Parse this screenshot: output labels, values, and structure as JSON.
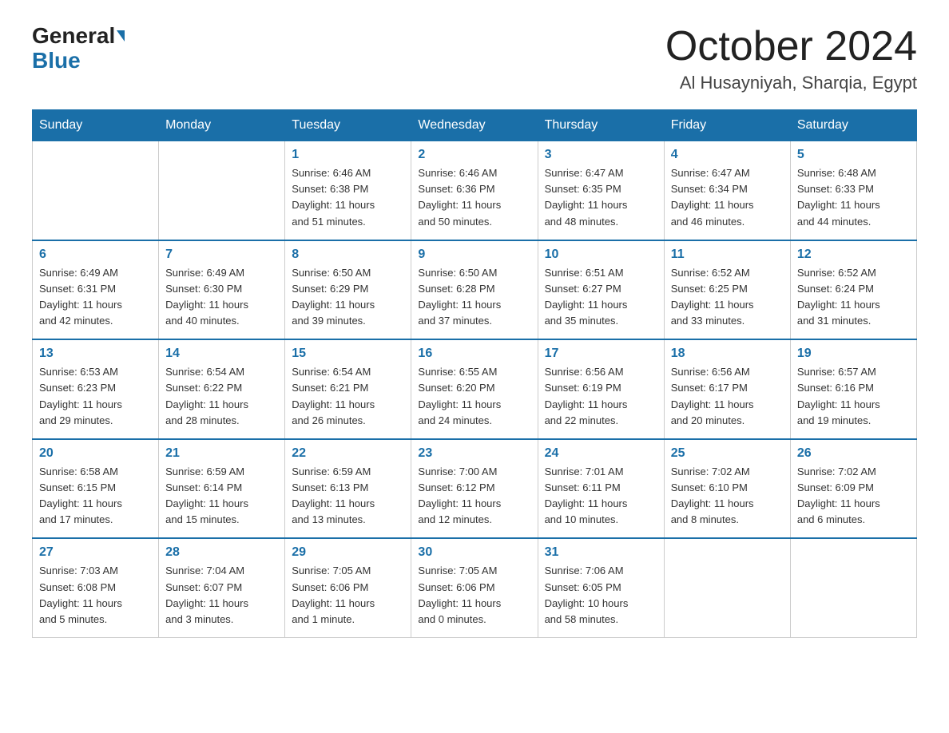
{
  "header": {
    "logo_general": "General",
    "logo_blue": "Blue",
    "title": "October 2024",
    "subtitle": "Al Husayniyah, Sharqia, Egypt"
  },
  "weekdays": [
    "Sunday",
    "Monday",
    "Tuesday",
    "Wednesday",
    "Thursday",
    "Friday",
    "Saturday"
  ],
  "weeks": [
    [
      {
        "day": "",
        "info": ""
      },
      {
        "day": "",
        "info": ""
      },
      {
        "day": "1",
        "info": "Sunrise: 6:46 AM\nSunset: 6:38 PM\nDaylight: 11 hours\nand 51 minutes."
      },
      {
        "day": "2",
        "info": "Sunrise: 6:46 AM\nSunset: 6:36 PM\nDaylight: 11 hours\nand 50 minutes."
      },
      {
        "day": "3",
        "info": "Sunrise: 6:47 AM\nSunset: 6:35 PM\nDaylight: 11 hours\nand 48 minutes."
      },
      {
        "day": "4",
        "info": "Sunrise: 6:47 AM\nSunset: 6:34 PM\nDaylight: 11 hours\nand 46 minutes."
      },
      {
        "day": "5",
        "info": "Sunrise: 6:48 AM\nSunset: 6:33 PM\nDaylight: 11 hours\nand 44 minutes."
      }
    ],
    [
      {
        "day": "6",
        "info": "Sunrise: 6:49 AM\nSunset: 6:31 PM\nDaylight: 11 hours\nand 42 minutes."
      },
      {
        "day": "7",
        "info": "Sunrise: 6:49 AM\nSunset: 6:30 PM\nDaylight: 11 hours\nand 40 minutes."
      },
      {
        "day": "8",
        "info": "Sunrise: 6:50 AM\nSunset: 6:29 PM\nDaylight: 11 hours\nand 39 minutes."
      },
      {
        "day": "9",
        "info": "Sunrise: 6:50 AM\nSunset: 6:28 PM\nDaylight: 11 hours\nand 37 minutes."
      },
      {
        "day": "10",
        "info": "Sunrise: 6:51 AM\nSunset: 6:27 PM\nDaylight: 11 hours\nand 35 minutes."
      },
      {
        "day": "11",
        "info": "Sunrise: 6:52 AM\nSunset: 6:25 PM\nDaylight: 11 hours\nand 33 minutes."
      },
      {
        "day": "12",
        "info": "Sunrise: 6:52 AM\nSunset: 6:24 PM\nDaylight: 11 hours\nand 31 minutes."
      }
    ],
    [
      {
        "day": "13",
        "info": "Sunrise: 6:53 AM\nSunset: 6:23 PM\nDaylight: 11 hours\nand 29 minutes."
      },
      {
        "day": "14",
        "info": "Sunrise: 6:54 AM\nSunset: 6:22 PM\nDaylight: 11 hours\nand 28 minutes."
      },
      {
        "day": "15",
        "info": "Sunrise: 6:54 AM\nSunset: 6:21 PM\nDaylight: 11 hours\nand 26 minutes."
      },
      {
        "day": "16",
        "info": "Sunrise: 6:55 AM\nSunset: 6:20 PM\nDaylight: 11 hours\nand 24 minutes."
      },
      {
        "day": "17",
        "info": "Sunrise: 6:56 AM\nSunset: 6:19 PM\nDaylight: 11 hours\nand 22 minutes."
      },
      {
        "day": "18",
        "info": "Sunrise: 6:56 AM\nSunset: 6:17 PM\nDaylight: 11 hours\nand 20 minutes."
      },
      {
        "day": "19",
        "info": "Sunrise: 6:57 AM\nSunset: 6:16 PM\nDaylight: 11 hours\nand 19 minutes."
      }
    ],
    [
      {
        "day": "20",
        "info": "Sunrise: 6:58 AM\nSunset: 6:15 PM\nDaylight: 11 hours\nand 17 minutes."
      },
      {
        "day": "21",
        "info": "Sunrise: 6:59 AM\nSunset: 6:14 PM\nDaylight: 11 hours\nand 15 minutes."
      },
      {
        "day": "22",
        "info": "Sunrise: 6:59 AM\nSunset: 6:13 PM\nDaylight: 11 hours\nand 13 minutes."
      },
      {
        "day": "23",
        "info": "Sunrise: 7:00 AM\nSunset: 6:12 PM\nDaylight: 11 hours\nand 12 minutes."
      },
      {
        "day": "24",
        "info": "Sunrise: 7:01 AM\nSunset: 6:11 PM\nDaylight: 11 hours\nand 10 minutes."
      },
      {
        "day": "25",
        "info": "Sunrise: 7:02 AM\nSunset: 6:10 PM\nDaylight: 11 hours\nand 8 minutes."
      },
      {
        "day": "26",
        "info": "Sunrise: 7:02 AM\nSunset: 6:09 PM\nDaylight: 11 hours\nand 6 minutes."
      }
    ],
    [
      {
        "day": "27",
        "info": "Sunrise: 7:03 AM\nSunset: 6:08 PM\nDaylight: 11 hours\nand 5 minutes."
      },
      {
        "day": "28",
        "info": "Sunrise: 7:04 AM\nSunset: 6:07 PM\nDaylight: 11 hours\nand 3 minutes."
      },
      {
        "day": "29",
        "info": "Sunrise: 7:05 AM\nSunset: 6:06 PM\nDaylight: 11 hours\nand 1 minute."
      },
      {
        "day": "30",
        "info": "Sunrise: 7:05 AM\nSunset: 6:06 PM\nDaylight: 11 hours\nand 0 minutes."
      },
      {
        "day": "31",
        "info": "Sunrise: 7:06 AM\nSunset: 6:05 PM\nDaylight: 10 hours\nand 58 minutes."
      },
      {
        "day": "",
        "info": ""
      },
      {
        "day": "",
        "info": ""
      }
    ]
  ]
}
